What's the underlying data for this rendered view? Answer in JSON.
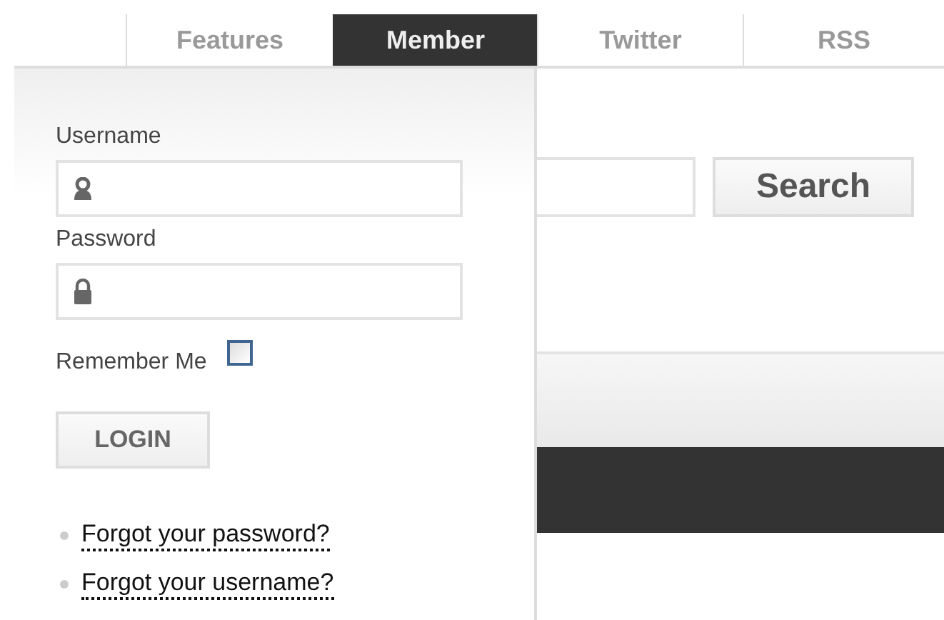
{
  "tabs": [
    {
      "label": "Features",
      "selected": false
    },
    {
      "label": "Member",
      "selected": true
    },
    {
      "label": "Twitter",
      "selected": false
    },
    {
      "label": "RSS",
      "selected": false
    }
  ],
  "login": {
    "username_label": "Username",
    "password_label": "Password",
    "remember_label": "Remember Me",
    "remember_checked": false,
    "login_button": "LOGIN",
    "links": [
      "Forgot your password?",
      "Forgot your username?"
    ]
  },
  "search": {
    "button": "Search"
  }
}
